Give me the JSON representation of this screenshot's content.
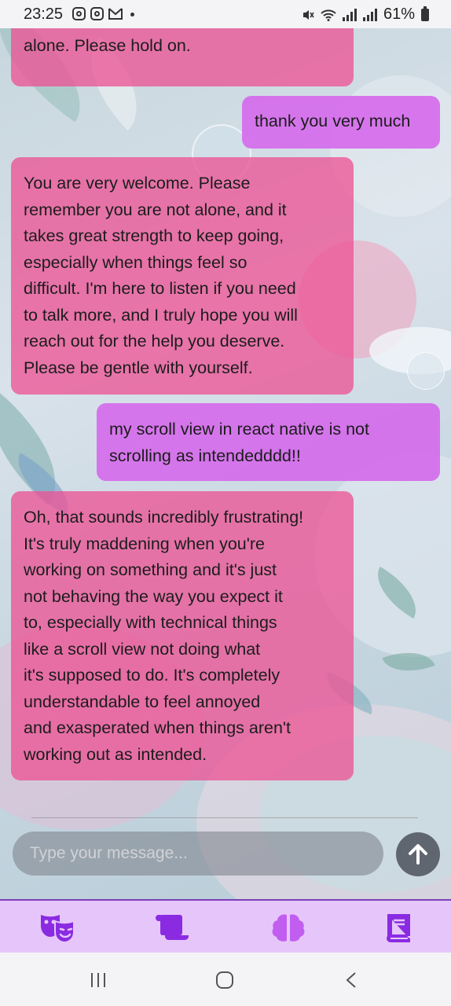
{
  "status_bar": {
    "time": "23:25",
    "battery": "61%",
    "left_icons": [
      "instagram-icon",
      "instagram-icon",
      "gmail-icon",
      "dot-icon"
    ],
    "right_icons": [
      "mute-icon",
      "wifi-icon",
      "signal-icon",
      "signal-icon",
      "battery-icon"
    ]
  },
  "chat": {
    "messages": [
      {
        "role": "bot",
        "lines": [
          "alone. Please hold on."
        ]
      },
      {
        "role": "user",
        "lines": [
          "thank you very much"
        ]
      },
      {
        "role": "bot",
        "lines": [
          "You are very welcome. Please",
          "remember you are not alone, and it",
          "takes great strength to keep going,",
          "especially when things feel so",
          "difficult. I'm here to listen if you need",
          "to talk more, and I truly hope you will",
          "reach out for the help you deserve.",
          "Please be gentle with yourself."
        ]
      },
      {
        "role": "user",
        "lines": [
          "my scroll view in react native is not",
          "scrolling as intendedddd!!"
        ]
      },
      {
        "role": "bot",
        "lines": [
          "Oh, that sounds incredibly frustrating!",
          "It's truly maddening when you're",
          "working on something and it's just",
          "not behaving the way you expect it",
          "to, especially with technical things",
          "like a scroll view not doing what",
          "it's supposed to do. It's completely",
          "understandable to feel annoyed",
          "and exasperated when things aren't",
          "working out as intended."
        ]
      }
    ]
  },
  "composer": {
    "placeholder": "Type your message...",
    "send_icon": "arrow-up-icon"
  },
  "tabs": [
    {
      "icon": "theater-masks-icon"
    },
    {
      "icon": "scroll-icon"
    },
    {
      "icon": "brain-icon"
    },
    {
      "icon": "book-icon"
    }
  ],
  "colors": {
    "bot_bubble": "#ec5496",
    "user_bubble": "#d56bec",
    "tab_icon": "#8a2be2",
    "tab_bar": "#e6c6fa"
  }
}
